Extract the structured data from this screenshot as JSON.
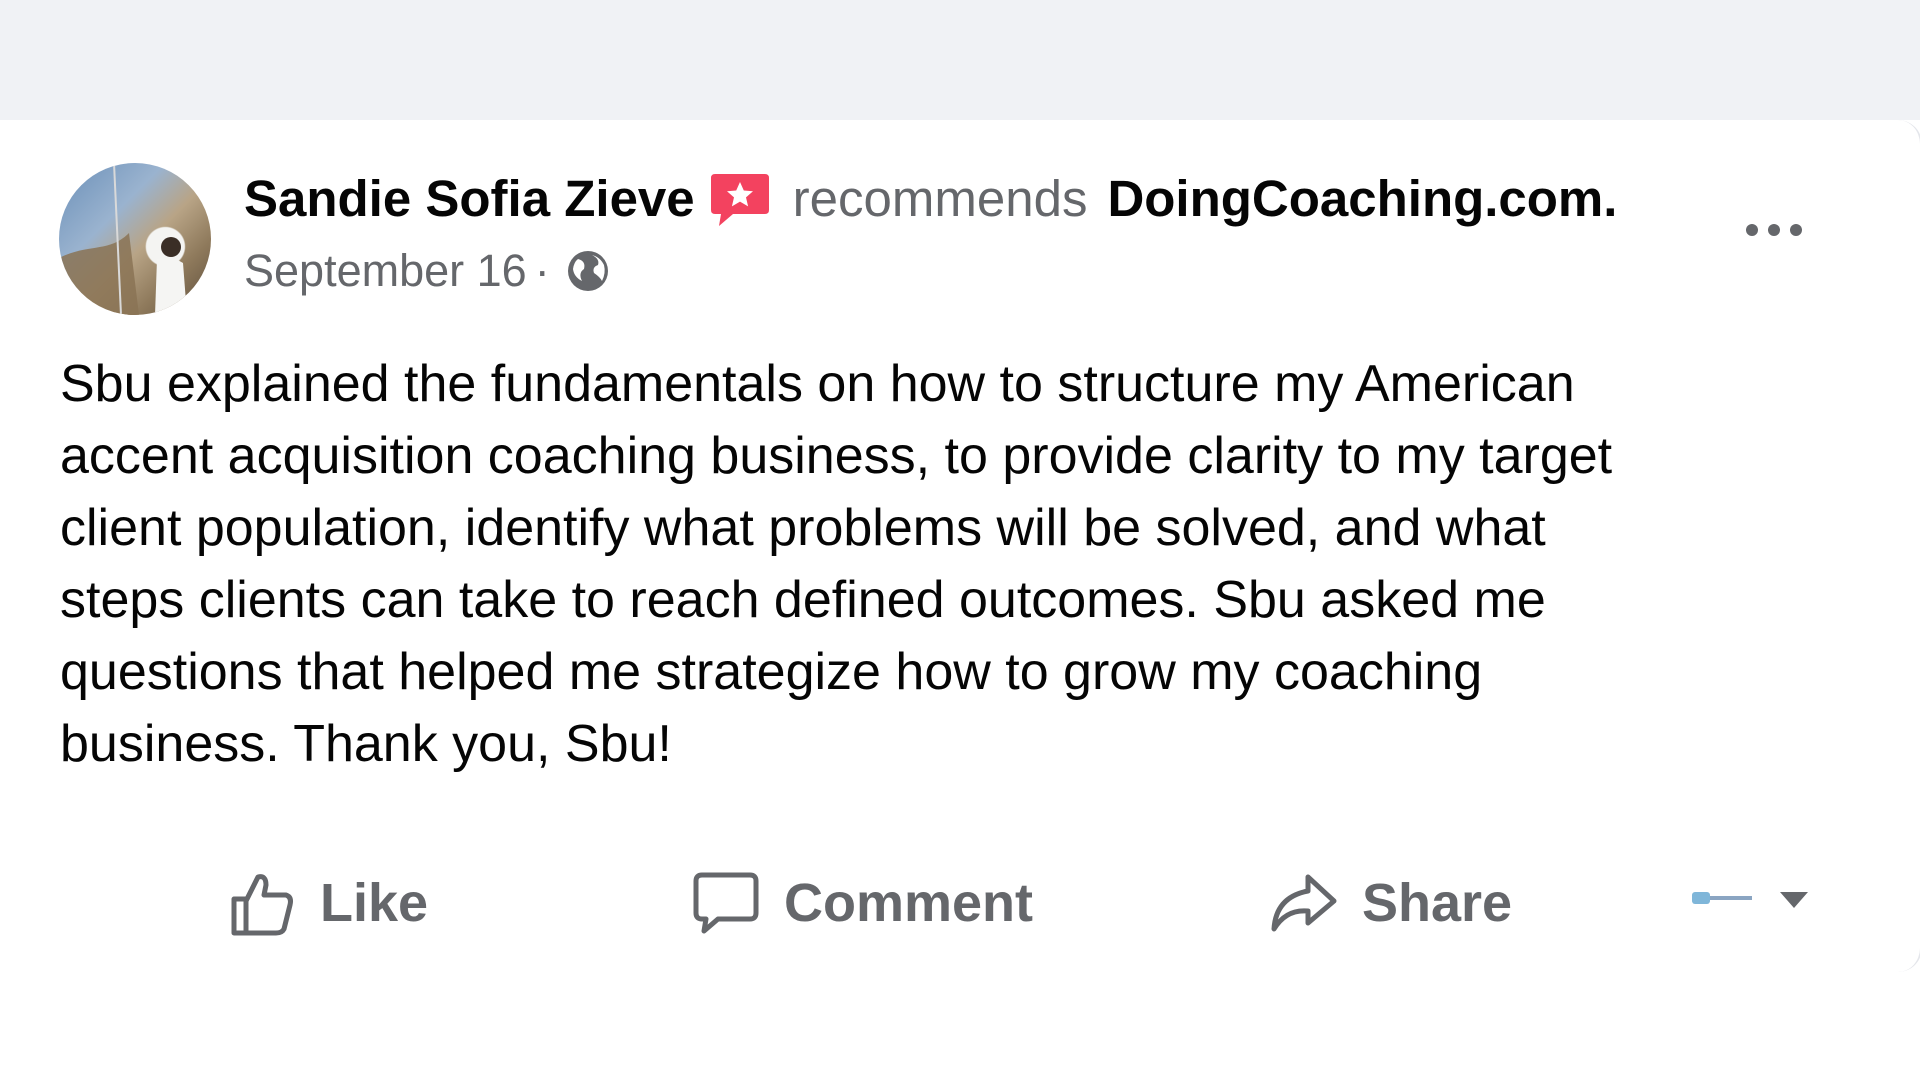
{
  "post": {
    "author": "Sandie Sofia Zieve",
    "recommends_word": "recommends",
    "page_name": "DoingCoaching.com.",
    "date": "September 16",
    "separator": "·",
    "audience_icon": "globe-icon",
    "recommendation_icon": "recommendation-star-badge",
    "body_lines": [
      "Sbu explained the fundamentals on how to structure my American",
      "accent acquisition coaching business, to provide clarity to my target",
      "client population, identify what problems will be solved, and what",
      "steps clients can take to reach defined outcomes. Sbu asked me",
      "questions that helped me strategize how to grow my coaching",
      "business. Thank you, Sbu!"
    ]
  },
  "actions": {
    "like": "Like",
    "comment": "Comment",
    "share": "Share"
  },
  "colors": {
    "text_primary": "#050505",
    "text_secondary": "#65676b",
    "recommend_badge": "#f3425f",
    "page_background": "#f0f2f5"
  }
}
